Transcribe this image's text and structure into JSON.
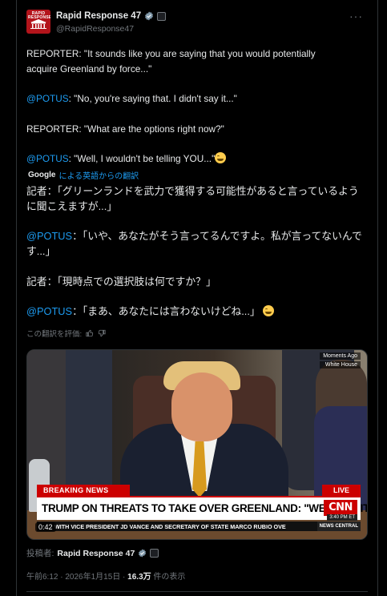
{
  "author": {
    "display_name": "Rapid Response 47",
    "handle": "@RapidResponse47",
    "avatar_text": "RAPID RESPONSE",
    "more_label": "···"
  },
  "post": {
    "lines": [
      {
        "prefix": "",
        "text": "REPORTER: \"It sounds like you are saying that you would potentially"
      },
      {
        "prefix": "",
        "text": "acquire Greenland by force...\""
      },
      {
        "prefix": "@POTUS",
        "text": ": \"No, you're saying that. I didn't say it...\""
      },
      {
        "prefix": "",
        "text": "REPORTER: \"What are the options right now?\""
      },
      {
        "prefix": "@POTUS",
        "text": ": \"Well, I wouldn't be telling YOU...\""
      }
    ]
  },
  "translation": {
    "google_label": "Google",
    "label": "による英語からの翻訳",
    "lines": [
      {
        "prefix": "",
        "text": "記者：「グリーンランドを武力で獲得する可能性があると言っているよう"
      },
      {
        "prefix": "",
        "text": "に聞こえますが...」"
      },
      {
        "prefix": "@POTUS",
        "text": "：「いや、あなたがそう言ってるんですよ。私が言ってないんで"
      },
      {
        "prefix": "",
        "text": "す...」"
      },
      {
        "prefix": "",
        "text": "記者：「現時点での選択肢は何ですか？」"
      },
      {
        "prefix": "@POTUS",
        "text": "：「まあ、あなたには言わないけどね...」"
      }
    ],
    "rate_label": "この翻訳を評価:"
  },
  "video": {
    "corner_top": "Moments Ago",
    "corner_bottom": "White House",
    "breaking": "BREAKING NEWS",
    "live": "LIVE",
    "headline": "TRUMP ON THREATS TO TAKE OVER GREENLAND: \"WE NEED IT\"",
    "network": "CNN",
    "time": "3:40 PM ET",
    "ticker": "WITH VICE PRESIDENT JD VANCE AND SECRETARY OF STATE MARCO RUBIO OVE",
    "news_central": "NEWS CENTRAL",
    "duration": "0:42"
  },
  "footer": {
    "posted_by_label": "投稿者:",
    "posted_by_name": "Rapid Response 47",
    "timestamp": "午前6:12 · 2026年1月15日 · ",
    "views_count": "16.3万",
    "views_label": " 件の表示"
  },
  "colors": {
    "background": "#000000",
    "text": "#e7e9ea",
    "muted": "#71767b",
    "link": "#1d9bf0",
    "cnn_red": "#cc0000",
    "verified": "#829aab"
  },
  "icons": [
    "verified-icon",
    "affiliate-badge-icon",
    "more-icon",
    "thumbs-up-icon",
    "thumbs-down-icon",
    "laughing-emoji-icon"
  ]
}
